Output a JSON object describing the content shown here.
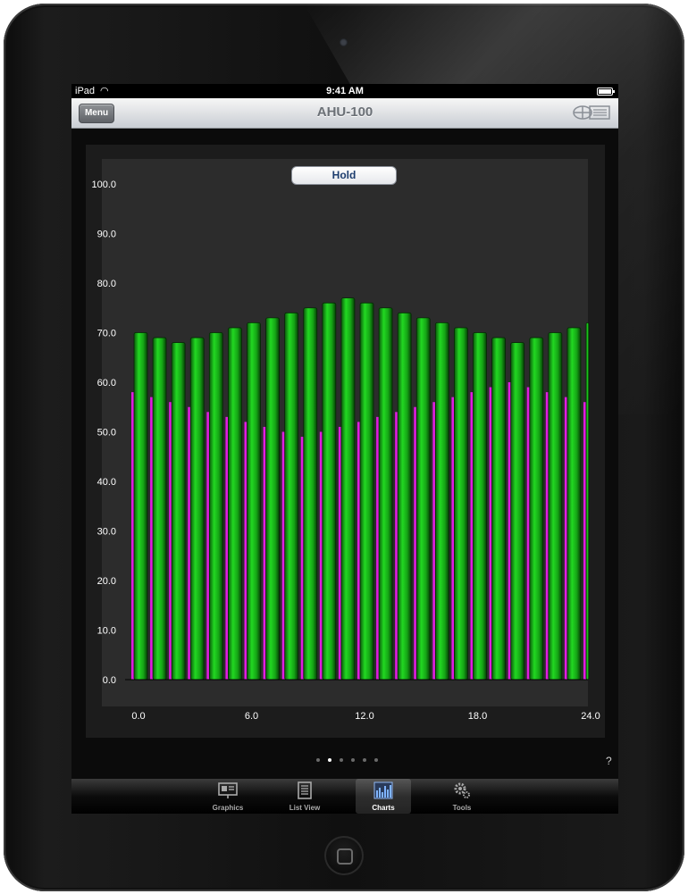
{
  "status_bar": {
    "carrier": "iPad",
    "time": "9:41 AM"
  },
  "nav": {
    "menu_label": "Menu",
    "title": "AHU-100"
  },
  "hold_label": "Hold",
  "help_label": "?",
  "pager": {
    "count": 6,
    "active_index": 1
  },
  "tabs": [
    {
      "label": "Graphics",
      "icon": "graphics-icon",
      "active": false
    },
    {
      "label": "List View",
      "icon": "list-view-icon",
      "active": false
    },
    {
      "label": "Charts",
      "icon": "charts-icon",
      "active": true
    },
    {
      "label": "Tools",
      "icon": "gears-icon",
      "active": false
    }
  ],
  "chart_data": {
    "type": "bar",
    "x": [
      0,
      1,
      2,
      3,
      4,
      5,
      6,
      7,
      8,
      9,
      10,
      11,
      12,
      13,
      14,
      15,
      16,
      17,
      18,
      19,
      20,
      21,
      22,
      23,
      24
    ],
    "x_tick_labels": [
      "0.0",
      "6.0",
      "12.0",
      "18.0",
      "24.0"
    ],
    "x_ticks": [
      0,
      6,
      12,
      18,
      24
    ],
    "y_tick_labels": [
      "0.0",
      "10.0",
      "20.0",
      "30.0",
      "40.0",
      "50.0",
      "60.0",
      "70.0",
      "80.0",
      "90.0",
      "100.0"
    ],
    "ylim": [
      0,
      100
    ],
    "xlim": [
      0,
      24
    ],
    "series": [
      {
        "color": "#e01de0",
        "values": [
          58,
          57,
          56,
          55,
          54,
          53,
          52,
          51,
          50,
          49,
          50,
          51,
          52,
          53,
          54,
          55,
          56,
          57,
          58,
          59,
          60,
          59,
          58,
          57,
          56
        ]
      },
      {
        "color": "#1ed01e",
        "values": [
          70,
          69,
          68,
          69,
          70,
          71,
          72,
          73,
          74,
          75,
          76,
          77,
          76,
          75,
          74,
          73,
          72,
          71,
          70,
          69,
          68,
          69,
          70,
          71,
          72
        ]
      }
    ]
  },
  "colors": {
    "bar_green": "#1ed01e",
    "bar_green_dark": "#0a5f0a",
    "bar_magenta": "#e01de0",
    "axis_label": "#ffffff"
  }
}
